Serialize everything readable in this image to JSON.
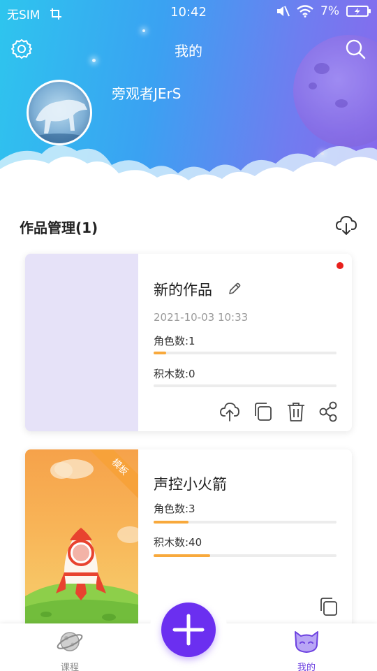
{
  "status_bar": {
    "carrier": "无SIM",
    "time": "10:42",
    "battery": "7%"
  },
  "header": {
    "title": "我的",
    "username": "旁观者JErS"
  },
  "works": {
    "section_title": "作品管理(1)",
    "items": [
      {
        "name": "新的作品",
        "date": "2021-10-03 10:33",
        "role_label": "角色数:1",
        "block_label": "积木数:0",
        "role_fill": 0.07,
        "block_fill": 0.0,
        "unread": true
      },
      {
        "name": "声控小火箭",
        "badge": "模板",
        "role_label": "角色数:3",
        "block_label": "积木数:40",
        "role_fill": 0.19,
        "block_fill": 0.31
      }
    ]
  },
  "bottom_nav": {
    "course_label": "课程",
    "mine_label": "我的"
  },
  "colors": {
    "accent": "#6b2ff0",
    "progress": "#f8a93c",
    "unread_dot": "#e8201c"
  },
  "icons": [
    "settings-icon",
    "search-icon",
    "cloud-download-icon",
    "edit-icon",
    "cloud-upload-icon",
    "copy-icon",
    "trash-icon",
    "share-icon",
    "planet-icon",
    "cat-icon",
    "plus-icon"
  ]
}
